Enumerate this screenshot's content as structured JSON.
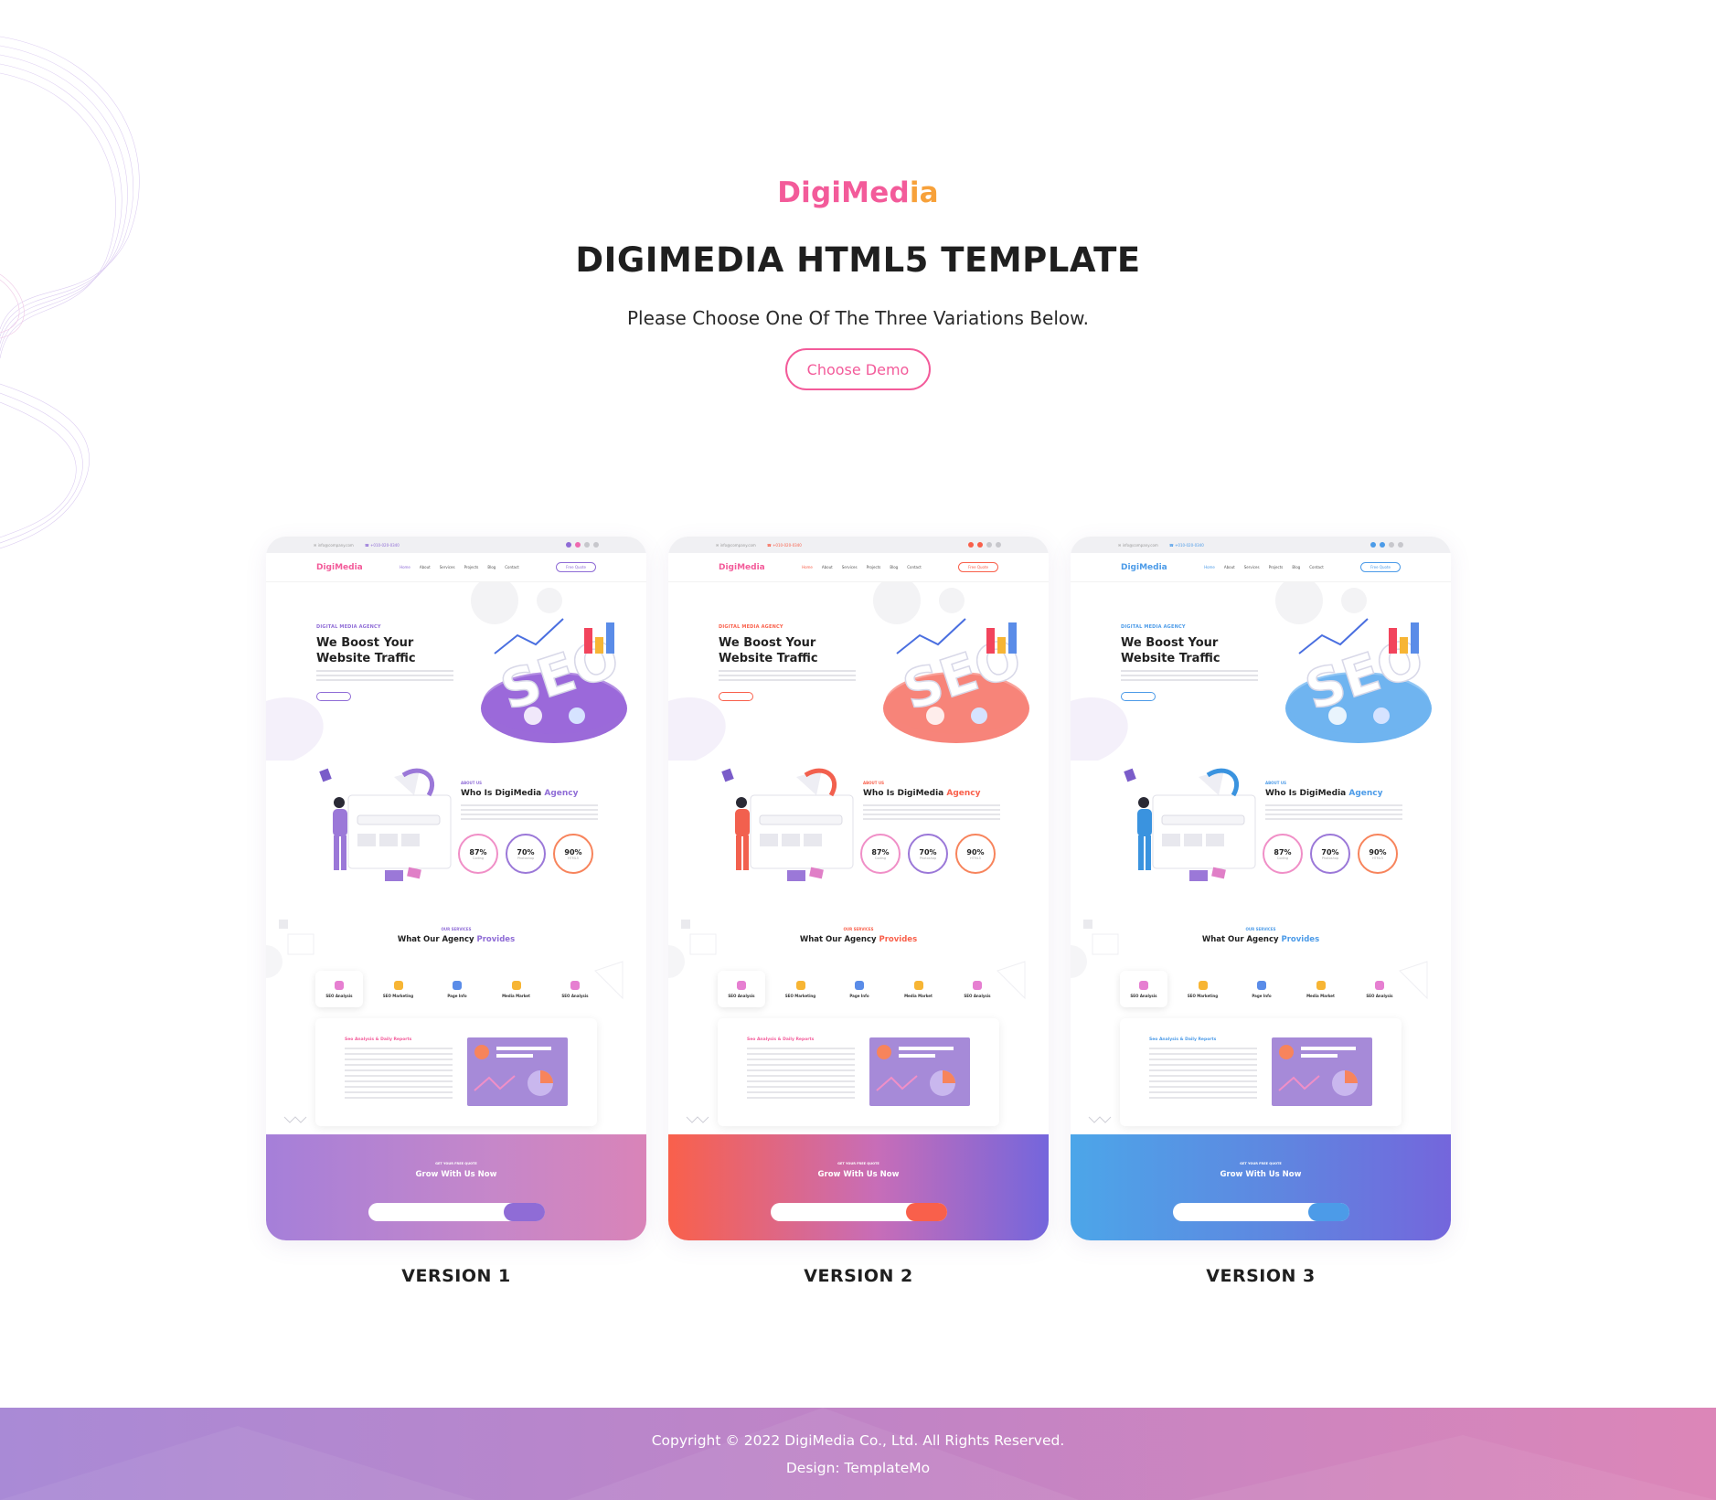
{
  "header": {
    "logo_main": "DigiMed",
    "logo_accent": "ia",
    "title": "DIGIMEDIA HTML5 TEMPLATE",
    "subtitle": "Please Choose One Of The Three Variations Below.",
    "choose_button": "Choose Demo"
  },
  "colors": {
    "brand_pink": "#f35b9a",
    "brand_orange": "#f7a13a",
    "v1_accent": "#8f6cd6",
    "v2_accent": "#f9604b",
    "v3_accent": "#4c9be8"
  },
  "preview": {
    "mini_logo": "DigiMedia",
    "menu": [
      "Home",
      "About",
      "Services",
      "Projects",
      "Blog",
      "Contact"
    ],
    "quote_button": "Free Quote",
    "tag": "DIGITAL MEDIA AGENCY",
    "headline": "We Boost Your Website Traffic",
    "about_tag": "ABOUT US",
    "about_title_prefix": "Who Is DigiMedia",
    "about_title_accent": "Agency",
    "rings": [
      {
        "pct": "87%",
        "label": "Coding"
      },
      {
        "pct": "70%",
        "label": "Photoshop"
      },
      {
        "pct": "90%",
        "label": "HTML5"
      }
    ],
    "svc_tag": "OUR SERVICES",
    "svc_title_prefix": "What Our Agency",
    "svc_title_accent": "Provides",
    "services": [
      "SEO Analysis",
      "SEO Marketing",
      "Page Info",
      "Media Market",
      "SEO Analysis"
    ],
    "report_title": "Seo Analysis & Daily Reports",
    "cta_tag": "GET YOUR FREE QUOTE",
    "cta_title": "Grow With Us Now"
  },
  "versions": [
    {
      "label": "VERSION 1"
    },
    {
      "label": "VERSION 2"
    },
    {
      "label": "VERSION 3"
    }
  ],
  "footer": {
    "copyright": "Copyright © 2022 DigiMedia Co., Ltd. All Rights Reserved.",
    "design": "Design: TemplateMo"
  }
}
